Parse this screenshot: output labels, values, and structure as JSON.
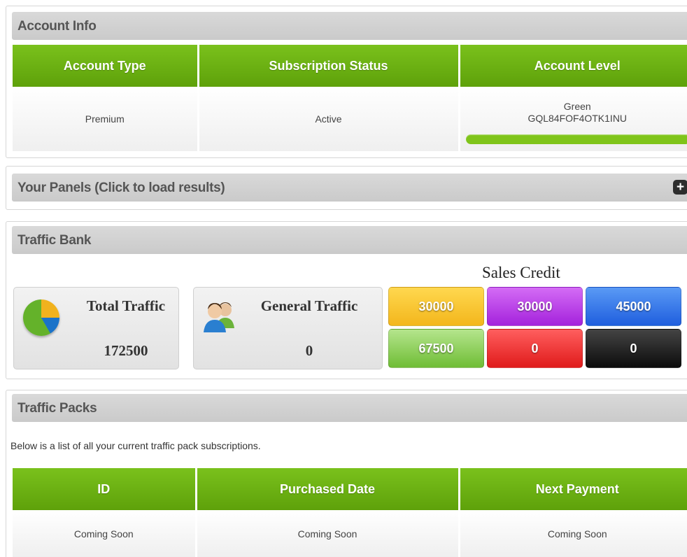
{
  "account_info": {
    "title": "Account Info",
    "columns": [
      "Account Type",
      "Subscription Status",
      "Account Level"
    ],
    "account_type": "Premium",
    "subscription_status": "Active",
    "level_name": "Green",
    "level_code": "GQL84FOF4OTK1INU",
    "level_bar_color": "#7fc41a"
  },
  "panels": {
    "title": "Your Panels (Click to load results)",
    "expand_icon": "plus-icon"
  },
  "traffic_bank": {
    "title": "Traffic Bank",
    "total_traffic_label": "Total Traffic",
    "total_traffic_value": "172500",
    "general_traffic_label": "General Traffic",
    "general_traffic_value": "0",
    "sales_credit_title": "Sales Credit",
    "credits": [
      {
        "value": "30000",
        "color": "yellow"
      },
      {
        "value": "30000",
        "color": "purple"
      },
      {
        "value": "45000",
        "color": "blue"
      },
      {
        "value": "67500",
        "color": "green"
      },
      {
        "value": "0",
        "color": "red"
      },
      {
        "value": "0",
        "color": "black"
      }
    ]
  },
  "traffic_packs": {
    "title": "Traffic Packs",
    "intro": "Below is a list of all your current traffic pack subscriptions.",
    "columns": [
      "ID",
      "Purchased Date",
      "Next Payment"
    ],
    "rows": [
      [
        "Coming Soon",
        "Coming Soon",
        "Coming Soon"
      ]
    ]
  },
  "colors": {
    "accent_green": "#6ab315",
    "header_gray": "#d2d2d2"
  }
}
